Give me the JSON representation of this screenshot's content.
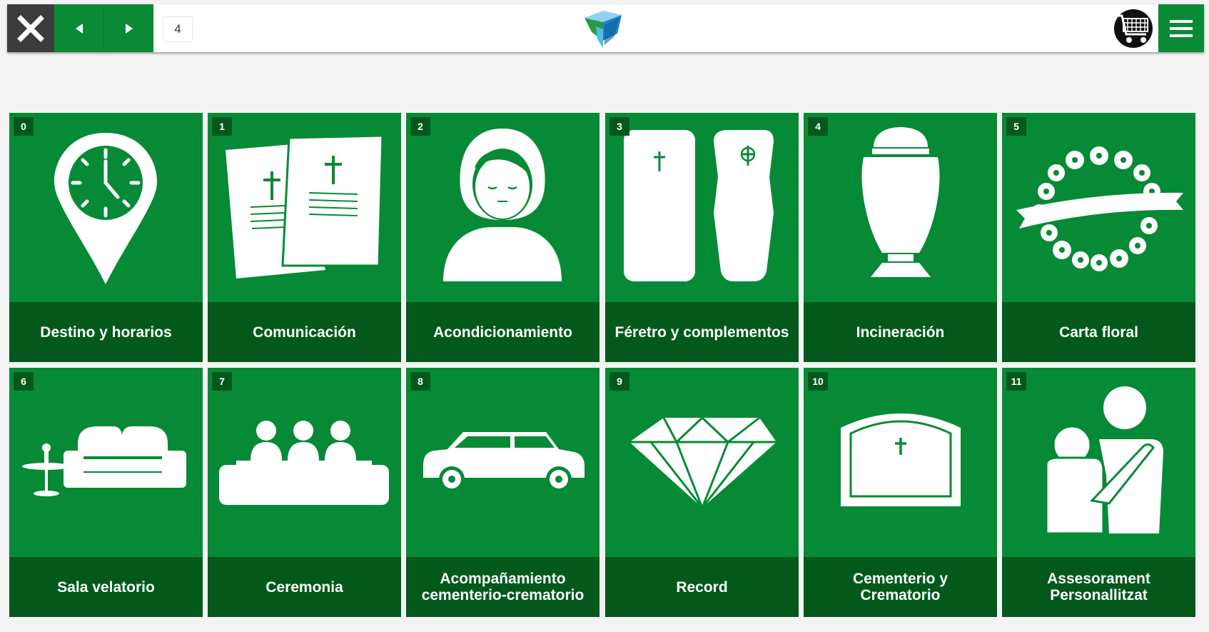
{
  "toolbar": {
    "page_number": "4",
    "icons": {
      "close": "close-icon",
      "prev": "triangle-left-icon",
      "next": "triangle-right-icon",
      "logo": "cube-logo",
      "cart": "shopping-cart-icon",
      "menu": "hamburger-menu-icon"
    }
  },
  "colors": {
    "tile_bg": "#078a36",
    "label_bg": "#03591c",
    "close_bg": "#3c3c3c",
    "nav_bg": "#0a8a35"
  },
  "tiles": [
    {
      "number": "0",
      "label": "Destino y horarios",
      "icon": "location-clock-icon"
    },
    {
      "number": "1",
      "label": "Comunicación",
      "icon": "documents-cross-icon"
    },
    {
      "number": "2",
      "label": "Acondicionamiento",
      "icon": "woman-portrait-icon"
    },
    {
      "number": "3",
      "label": "Féretro y complementos",
      "icon": "coffins-icon"
    },
    {
      "number": "4",
      "label": "Incineración",
      "icon": "urn-icon"
    },
    {
      "number": "5",
      "label": "Carta floral",
      "icon": "flower-wreath-icon"
    },
    {
      "number": "6",
      "label": "Sala velatorio",
      "icon": "sofa-table-icon"
    },
    {
      "number": "7",
      "label": "Ceremonia",
      "icon": "audience-icon"
    },
    {
      "number": "8",
      "label": "Acompañamiento\ncementerio-crematorio",
      "icon": "limousine-icon"
    },
    {
      "number": "9",
      "label": "Record",
      "icon": "diamond-icon"
    },
    {
      "number": "10",
      "label": "Cementerio y\nCrematorio",
      "icon": "tombstone-icon"
    },
    {
      "number": "11",
      "label": "Assesorament\nPersonallitzat",
      "icon": "consoling-people-icon"
    }
  ]
}
